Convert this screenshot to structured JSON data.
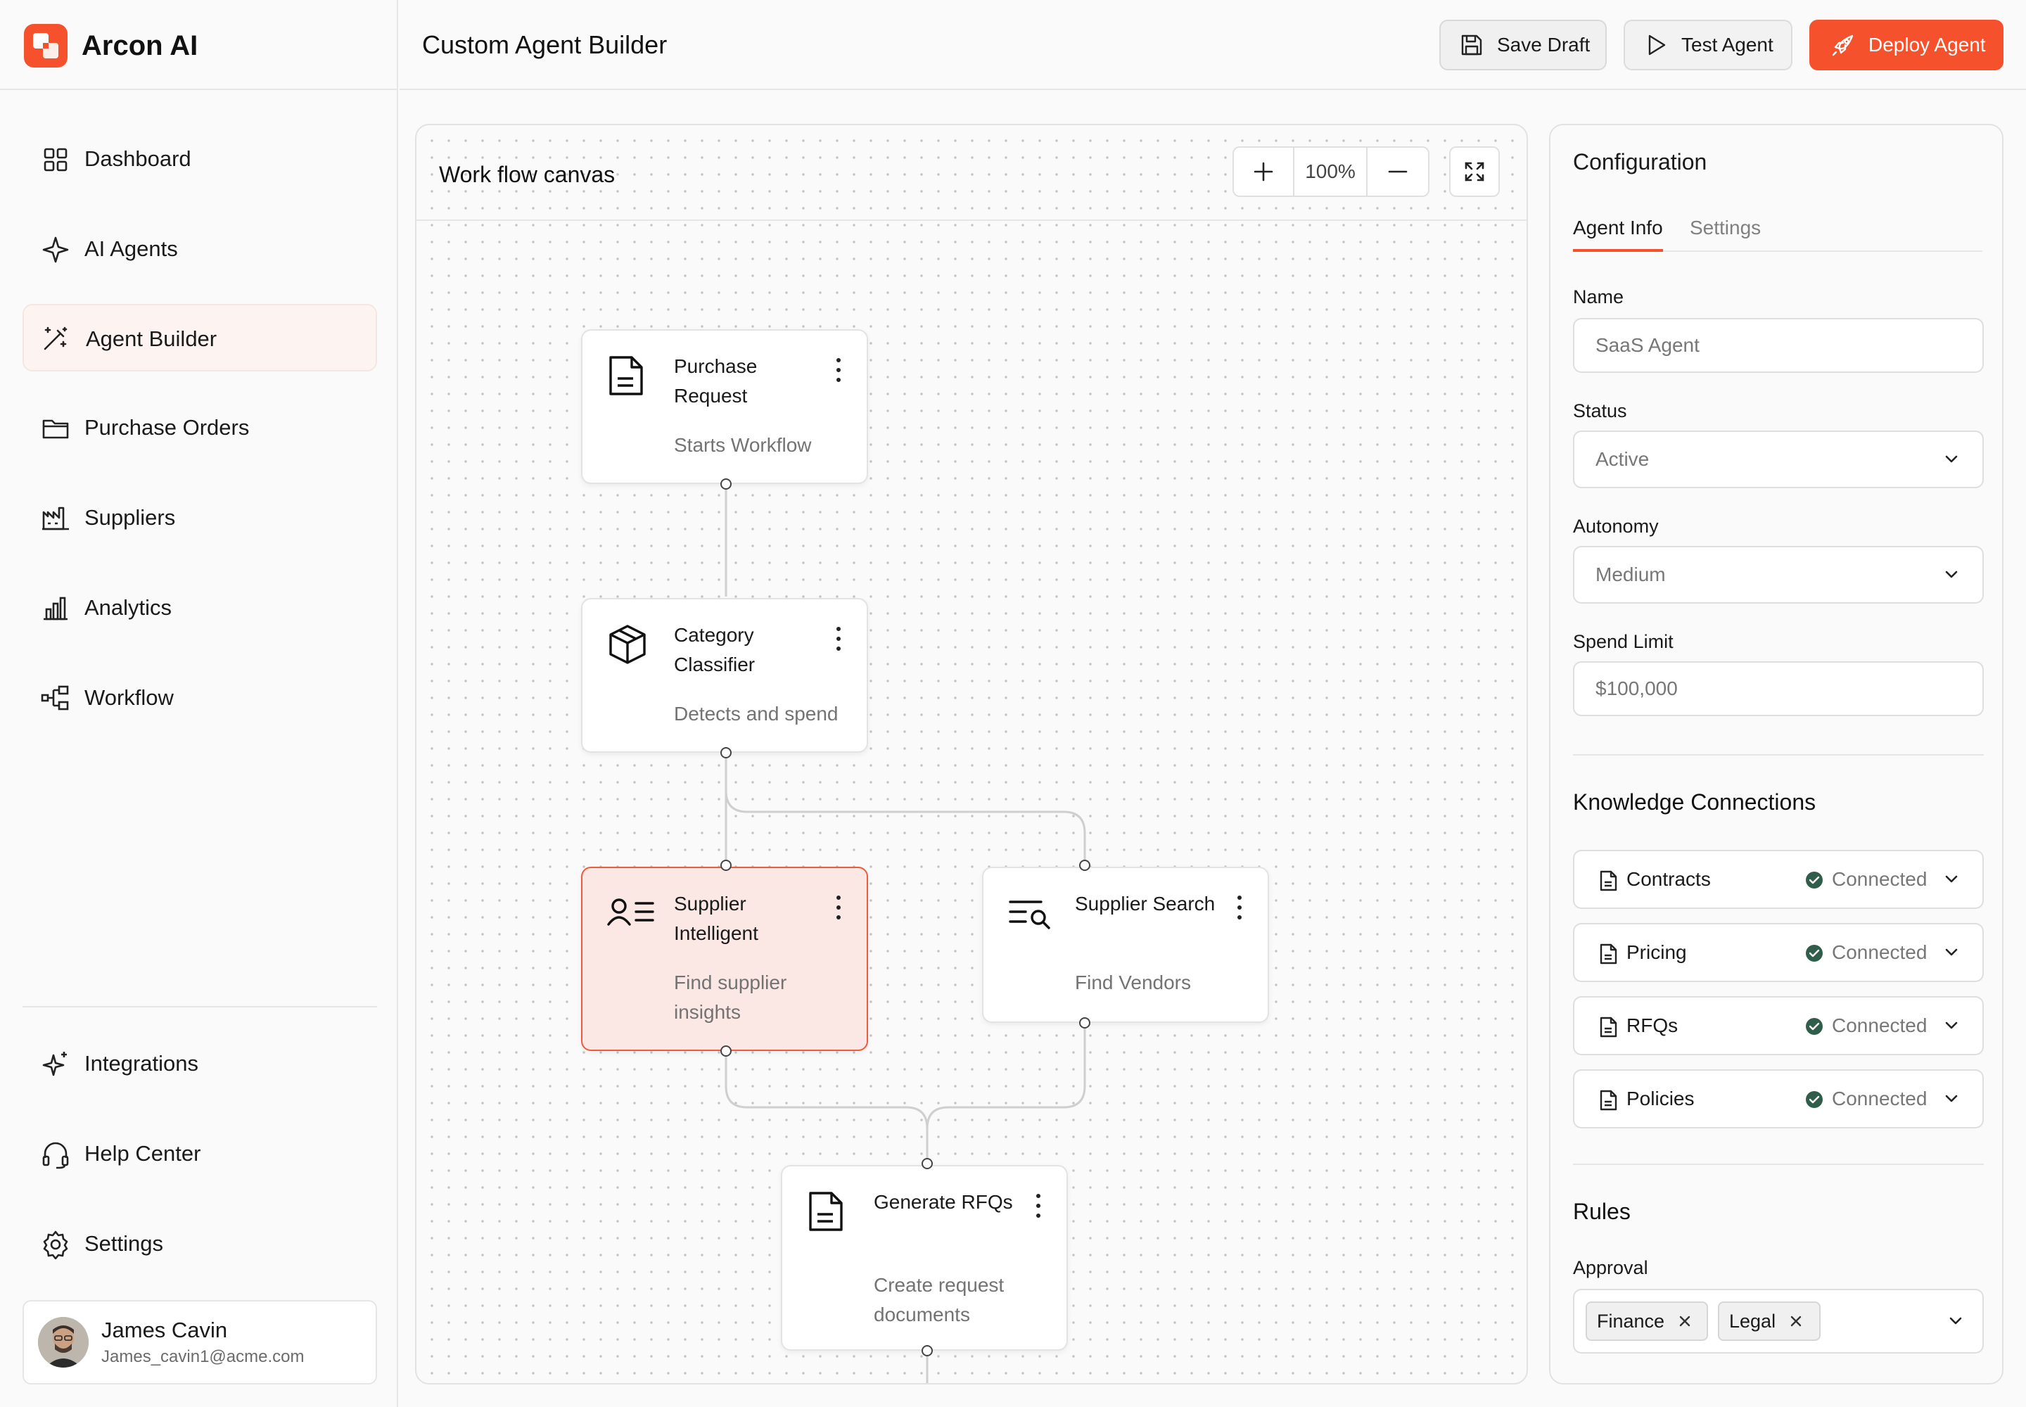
{
  "app": {
    "name": "Arcon AI",
    "accent": "#f4512c"
  },
  "header": {
    "title": "Custom Agent Builder",
    "save_label": "Save Draft",
    "test_label": "Test Agent",
    "deploy_label": "Deploy Agent"
  },
  "sidebar": {
    "items": [
      {
        "label": "Dashboard",
        "icon": "dashboard-icon"
      },
      {
        "label": "AI Agents",
        "icon": "sparkle-icon"
      },
      {
        "label": "Agent Builder",
        "icon": "magic-wand-icon",
        "active": true
      },
      {
        "label": "Purchase Orders",
        "icon": "folder-icon"
      },
      {
        "label": "Suppliers",
        "icon": "factory-icon"
      },
      {
        "label": "Analytics",
        "icon": "bar-chart-icon"
      },
      {
        "label": "Workflow",
        "icon": "workflow-icon"
      }
    ],
    "bottom_items": [
      {
        "label": "Integrations",
        "icon": "sparkles-icon"
      },
      {
        "label": "Help Center",
        "icon": "headset-icon"
      },
      {
        "label": "Settings",
        "icon": "gear-icon"
      }
    ],
    "user": {
      "name": "James Cavin",
      "email": "James_cavin1@acme.com"
    }
  },
  "canvas": {
    "title": "Work flow canvas",
    "zoom": "100%",
    "nodes": [
      {
        "title": "Purchase Request",
        "subtitle": "Starts Workflow",
        "icon": "document-icon"
      },
      {
        "title": "Category Classifier",
        "subtitle": "Detects and spend",
        "icon": "box-icon"
      },
      {
        "title": "Supplier Intelligent",
        "subtitle": "Find supplier insights",
        "icon": "user-list-icon",
        "selected": true
      },
      {
        "title": "Supplier Search",
        "subtitle": "Find Vendors",
        "icon": "list-search-icon"
      },
      {
        "title": "Generate RFQs",
        "subtitle": "Create request documents",
        "icon": "document-icon"
      }
    ]
  },
  "config": {
    "title": "Configuration",
    "tabs": [
      "Agent Info",
      "Settings"
    ],
    "name_label": "Name",
    "name_placeholder": "SaaS Agent",
    "status_label": "Status",
    "status_value": "Active",
    "autonomy_label": "Autonomy",
    "autonomy_value": "Medium",
    "spend_label": "Spend Limit",
    "spend_value": "$100,000",
    "knowledge_title": "Knowledge Connections",
    "connections": [
      {
        "name": "Contracts",
        "status": "Connected"
      },
      {
        "name": "Pricing",
        "status": "Connected"
      },
      {
        "name": "RFQs",
        "status": "Connected"
      },
      {
        "name": "Policies",
        "status": "Connected"
      }
    ],
    "rules_title": "Rules",
    "approval_label": "Approval",
    "approval_chips": [
      "Finance",
      "Legal"
    ]
  },
  "colors": {
    "connected": "#2f5e4a",
    "selected_node_bg": "#fbe7e3",
    "selected_node_border": "#ee5c3e"
  }
}
